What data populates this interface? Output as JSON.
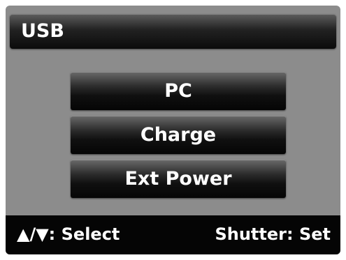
{
  "header": {
    "title": "USB"
  },
  "menu": {
    "items": [
      {
        "label": "PC"
      },
      {
        "label": "Charge"
      },
      {
        "label": "Ext Power"
      }
    ]
  },
  "footer": {
    "left_keys": "▲/▼:",
    "left_action": "Select",
    "right_key": "Shutter:",
    "right_action": "Set"
  }
}
